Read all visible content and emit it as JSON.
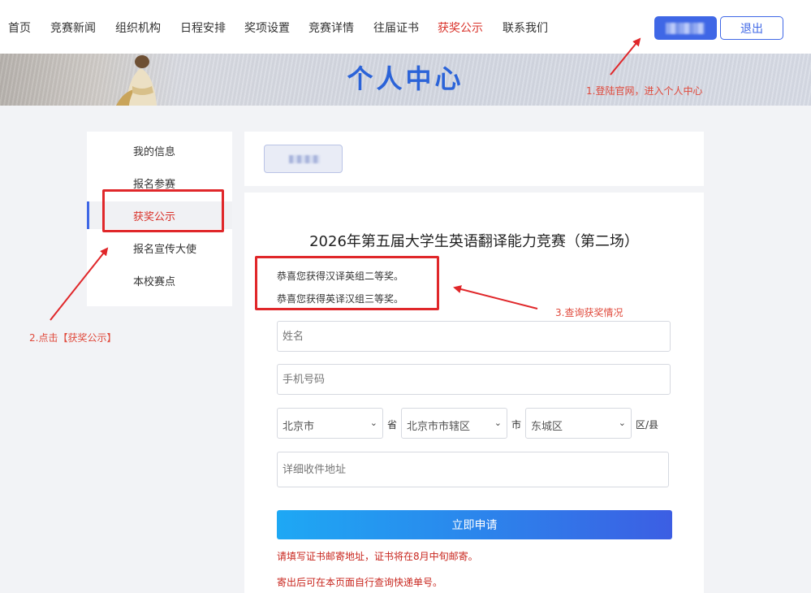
{
  "nav": {
    "items": [
      "首页",
      "竞赛新闻",
      "组织机构",
      "日程安排",
      "奖项设置",
      "竞赛详情",
      "往届证书",
      "获奖公示",
      "联系我们"
    ],
    "active": "获奖公示",
    "logout": "退出"
  },
  "banner": {
    "title": "个人中心"
  },
  "sidebar": {
    "items": [
      "我的信息",
      "报名参赛",
      "获奖公示",
      "报名宣传大使",
      "本校赛点"
    ],
    "active": "获奖公示"
  },
  "main": {
    "contest_title": "2026年第五届大学生英语翻译能力竞赛（第二场）",
    "awards": [
      "恭喜您获得汉译英组二等奖。",
      "恭喜您获得英译汉组三等奖。"
    ],
    "form": {
      "name_placeholder": "姓名",
      "phone_placeholder": "手机号码",
      "province": "北京市",
      "province_unit": "省",
      "city": "北京市市辖区",
      "city_unit": "市",
      "district": "东城区",
      "district_unit": "区/县",
      "address_placeholder": "详细收件地址",
      "submit": "立即申请"
    },
    "hints": [
      "请填写证书邮寄地址，证书将在8月中旬邮寄。",
      "寄出后可在本页面自行查询快递单号。"
    ]
  },
  "annotations": {
    "step1": "1.登陆官网，进入个人中心",
    "step2": "2.点击【获奖公示】",
    "step3": "3.查询获奖情况"
  },
  "colors": {
    "accent": "#3f67e6",
    "active_red": "#d9322a",
    "annotation_red": "#e0272a"
  }
}
